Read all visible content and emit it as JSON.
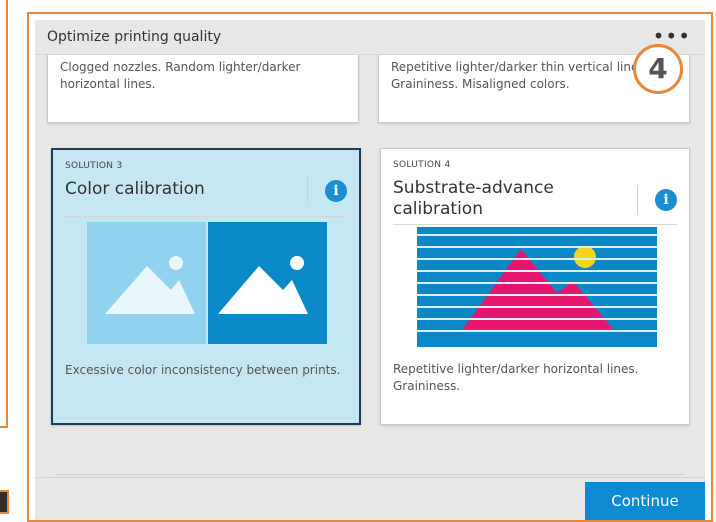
{
  "dialog": {
    "title": "Optimize printing quality",
    "more_icon": "more-horizontal-icon",
    "badge_number": "4",
    "continue_label": "Continue"
  },
  "solutions_partial": [
    {
      "description": "Clogged nozzles. Random lighter/darker horizontal lines."
    },
    {
      "description": "Repetitive lighter/darker thin vertical lines. Graininess. Misaligned colors."
    }
  ],
  "solutions": [
    {
      "label": "SOLUTION 3",
      "title": "Color calibration",
      "description": "Excessive color inconsistency between prints.",
      "selected": true,
      "icon": "info-icon"
    },
    {
      "label": "SOLUTION 4",
      "title": "Substrate-advance calibration",
      "description": "Repetitive lighter/darker horizontal lines. Graininess.",
      "selected": false,
      "icon": "info-icon"
    }
  ],
  "colors": {
    "accent": "#0c8ad2",
    "selected_bg": "#c5e6f3",
    "selected_border": "#1c3d5a",
    "highlight_orange": "#e8883a",
    "magenta": "#e8156f",
    "yellow": "#f5d51b"
  }
}
